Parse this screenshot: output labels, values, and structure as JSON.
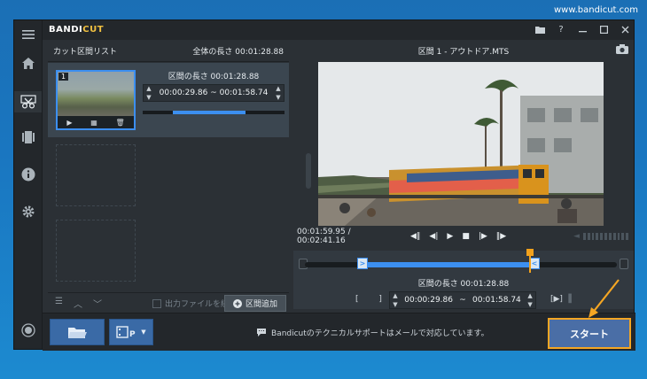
{
  "url": "www.bandicut.com",
  "app": {
    "logo_a": "BANDI",
    "logo_b": "CUT"
  },
  "rail": [
    "menu-icon",
    "home-icon",
    "cut-icon",
    "film-icon",
    "info-icon",
    "gear-icon",
    "record-icon"
  ],
  "left": {
    "title": "カット区間リスト",
    "total": "全体の長さ 00:01:28.88",
    "segment": {
      "number": "1",
      "length": "区間の長さ 00:01:28.88",
      "range": "00:00:29.86 ~ 00:01:58.74"
    },
    "merge_label": "出力ファイルを統合",
    "add_label": "区間追加"
  },
  "right": {
    "title": "区間 1 - アウトドア.MTS",
    "timecode": "00:01:59.95 / 00:02:41.16",
    "length": "区間の長さ 00:01:28.88",
    "range_start": "00:00:29.86",
    "tilde": "~",
    "range_end": "00:01:58.74",
    "bracket_left": "[ ]",
    "bracket_right": "[▶]"
  },
  "bottom": {
    "support_text": "Bandicutのテクニカルサポートはメールで対応しています。",
    "start_label": "スタート"
  },
  "colors": {
    "accent": "#3c8ff0",
    "highlight": "#f5a623",
    "panel": "#2b3035"
  }
}
